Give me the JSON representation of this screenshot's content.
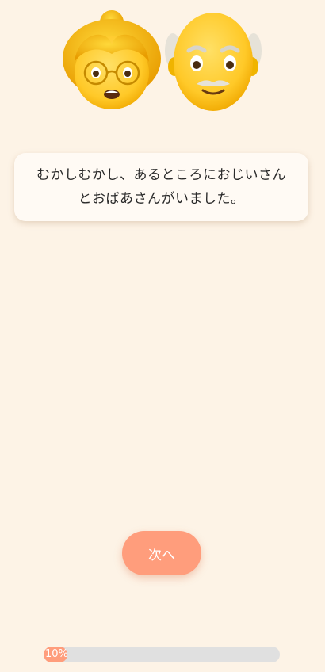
{
  "illustration": {
    "icons": [
      "old-woman-emoji",
      "old-man-emoji"
    ],
    "skin_color": "#ffc928"
  },
  "story": {
    "text": "むかしむかし、あるところにおじいさんとおばあさんがいました。"
  },
  "actions": {
    "next_label": "次へ"
  },
  "progress": {
    "value": 0.1,
    "label": "10%"
  },
  "colors": {
    "background": "#fdf3e6",
    "accent": "#ff9d7c",
    "track": "#e0e0e0",
    "card": "#fffaf4"
  }
}
